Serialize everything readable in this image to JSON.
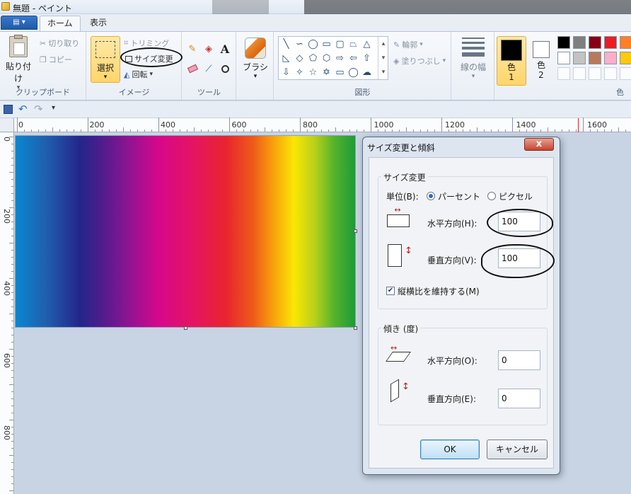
{
  "window": {
    "title": "無題 - ペイント"
  },
  "tabs": [
    {
      "label": "ホーム",
      "active": true
    },
    {
      "label": "表示",
      "active": false
    }
  ],
  "ribbon": {
    "clipboard": {
      "label": "クリップボード",
      "paste": "貼り付け",
      "cut": "切り取り",
      "copy": "コピー"
    },
    "image": {
      "label": "イメージ",
      "select": "選択",
      "crop": "トリミング",
      "resize": "サイズ変更",
      "rotate": "回転"
    },
    "tools": {
      "label": "ツール"
    },
    "brush": {
      "label": "ブラシ"
    },
    "shapes": {
      "label": "図形",
      "outline": "輪郭",
      "fill": "塗りつぶし"
    },
    "size": {
      "label": "線の幅"
    },
    "colors": {
      "label": "色",
      "color1": "色\n1",
      "color2": "色\n2",
      "color1_value": "#000000",
      "color2_value": "#ffffff",
      "palette_row1": [
        "#000000",
        "#7f7f7f",
        "#880015",
        "#ed1c24",
        "#ff7f27"
      ],
      "palette_row2": [
        "#ffffff",
        "#c3c3c3",
        "#b97a57",
        "#ffaec9",
        "#ffc90e"
      ]
    }
  },
  "ruler": {
    "h_labels": [
      "0",
      "200",
      "400",
      "600",
      "800",
      "1000",
      "1200",
      "1400",
      "1600"
    ],
    "v_labels": [
      "0",
      "200",
      "400",
      "600",
      "800"
    ]
  },
  "dialog": {
    "title": "サイズ変更と傾斜",
    "resize_section": "サイズ変更",
    "unit_label": "単位(B):",
    "unit_percent": "パーセント",
    "unit_pixel": "ピクセル",
    "unit_selected": "percent",
    "horizontal_label": "水平方向(H):",
    "horizontal_value": "100",
    "vertical_label": "垂直方向(V):",
    "vertical_value": "100",
    "keep_ratio_label": "縦横比を維持する(M)",
    "keep_ratio_checked": true,
    "skew_section": "傾き (度)",
    "skew_h_label": "水平方向(O):",
    "skew_h_value": "0",
    "skew_v_label": "垂直方向(E):",
    "skew_v_value": "0",
    "ok": "OK",
    "cancel": "キャンセル",
    "close_glyph": "x"
  }
}
